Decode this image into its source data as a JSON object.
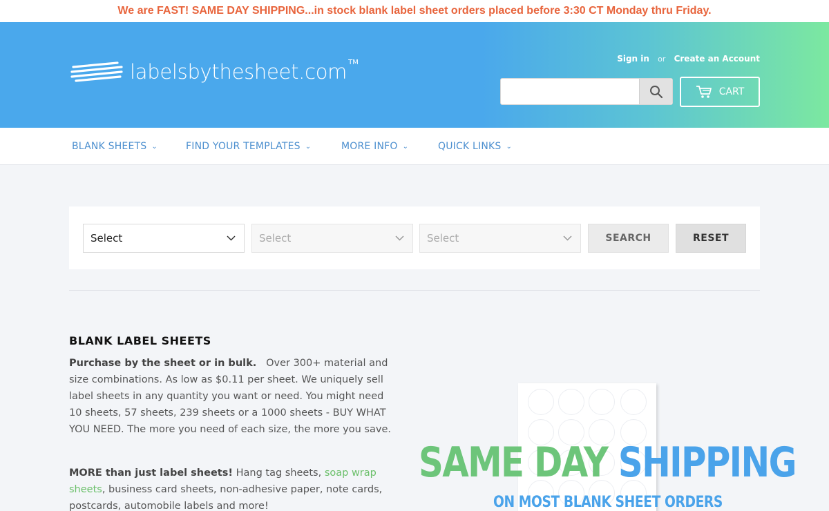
{
  "announcement": "We are FAST! SAME DAY SHIPPING...in stock blank label sheet orders placed before 3:30 CT Monday thru Friday.",
  "header": {
    "logo_text": "labelsbythesheet.com",
    "logo_tm": "TM",
    "signin": "Sign in",
    "or": "or",
    "create_account": "Create an Account",
    "search_placeholder": "",
    "cart_label": "CART",
    "icons": {
      "search": "search-icon",
      "cart": "cart-icon"
    }
  },
  "nav": {
    "items": [
      {
        "label": "BLANK SHEETS"
      },
      {
        "label": "FIND YOUR TEMPLATES"
      },
      {
        "label": "MORE INFO"
      },
      {
        "label": "QUICK LINKS"
      }
    ]
  },
  "filter": {
    "select1": "Select",
    "select2": "Select",
    "select3": "Select",
    "search_label": "SEARCH",
    "reset_label": "RESET"
  },
  "content": {
    "title": "BLANK LABEL SHEETS",
    "para1_bold": "Purchase by the sheet or in bulk.",
    "para1_text": "Over 300+ material and size combinations. As low as $0.11 per sheet. We uniquely sell label sheets in any quantity you want or need. You might need 10 sheets, 57 sheets, 239 sheets or a 1000 sheets - BUY WHAT YOU NEED. The more you need of each size, the more you save.",
    "para2_bold": "MORE than just label sheets!",
    "para2_text1": "Hang tag sheets,",
    "para2_link": "soap wrap sheets",
    "para2_text2": ", business card sheets, non-adhesive paper, note cards, postcards, automobile labels and more!"
  },
  "promo": {
    "word1": "SAME",
    "word2": "DAY",
    "word3": "SHIPPING",
    "subline": "ON MOST BLANK SHEET ORDERS"
  },
  "colors": {
    "announcement": "#e8643c",
    "header_blue": "#4aa8ec",
    "header_green": "#7ce8a0",
    "nav_text": "#4c8fcf",
    "link_green": "#6abf69",
    "promo_green": "#6dc57a",
    "promo_blue": "#4aa3ea"
  }
}
